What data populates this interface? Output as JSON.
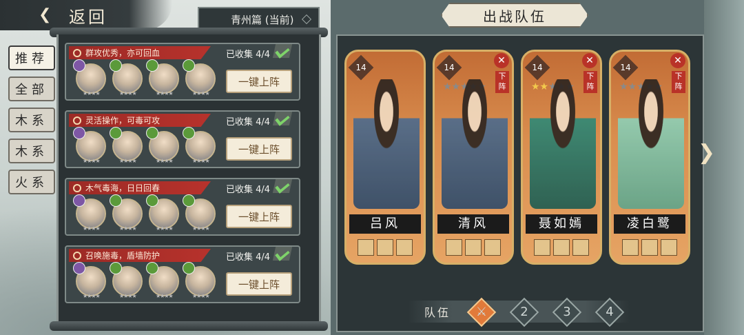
{
  "topbar": {
    "back_label": "返回",
    "chapter": "青州篇 (当前)"
  },
  "tabs": [
    "推荐",
    "全部",
    "木系",
    "木系",
    "火系"
  ],
  "recommend_cards": [
    {
      "desc": "群攻优秀，亦可回血",
      "collected": "已收集 4/4",
      "button": "一键上阵"
    },
    {
      "desc": "灵活操作，可毒可攻",
      "collected": "已收集 4/4",
      "button": "一键上阵"
    },
    {
      "desc": "木气毒海，日日回春",
      "collected": "已收集 4/4",
      "button": "一键上阵"
    },
    {
      "desc": "召唤施毒，盾墙防护",
      "collected": "已收集 4/4",
      "button": "一键上阵"
    }
  ],
  "lineup": {
    "title": "出战队伍",
    "heroes": [
      {
        "name": "吕风",
        "level": "14",
        "remove_label": "",
        "down_label": ""
      },
      {
        "name": "清风",
        "level": "14",
        "remove_label": "✕",
        "down_label": "下阵"
      },
      {
        "name": "聂如嫣",
        "level": "14",
        "remove_label": "✕",
        "down_label": "下阵"
      },
      {
        "name": "凌白鹭",
        "level": "14",
        "remove_label": "✕",
        "down_label": "下阵"
      }
    ],
    "team_label": "队伍",
    "teams": [
      "",
      "2",
      "3",
      "4"
    ]
  }
}
